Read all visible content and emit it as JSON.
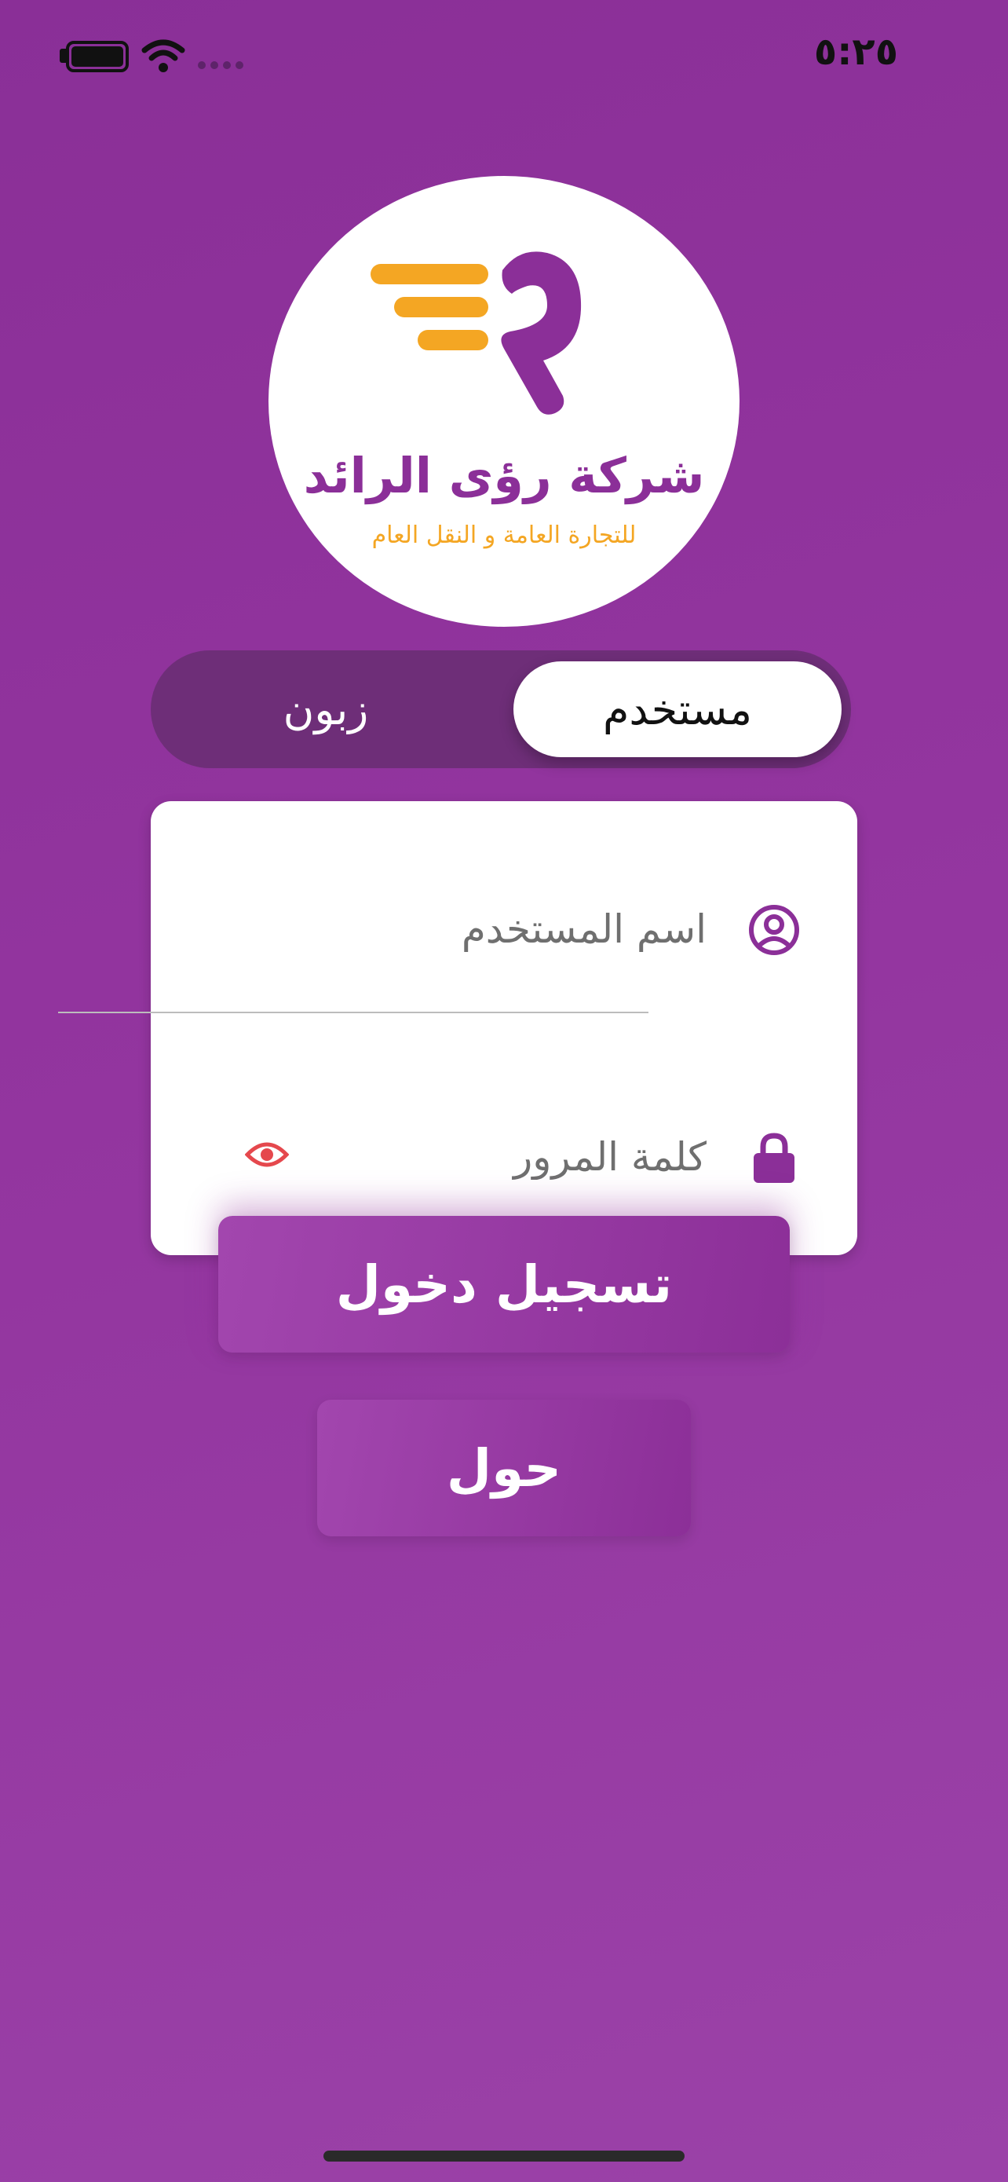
{
  "status_bar": {
    "time": "٥:٢٥"
  },
  "logo": {
    "title": "شركة رؤى الرائد",
    "subtitle": "للتجارة العامة و النقل العام",
    "colors": {
      "purple": "#8b2f98",
      "orange": "#f4a623"
    }
  },
  "account_type": {
    "options": [
      {
        "label": "مستخدم",
        "selected": true
      },
      {
        "label": "زبون",
        "selected": false
      }
    ]
  },
  "form": {
    "username": {
      "placeholder": "اسم المستخدم",
      "value": "",
      "icon": "user-circle-icon"
    },
    "password": {
      "placeholder": "كلمة المرور",
      "value": "",
      "icon": "lock-icon",
      "toggle_icon": "eye-icon"
    }
  },
  "buttons": {
    "login_label": "تسجيل دخول",
    "about_label": "حول"
  },
  "theme": {
    "background": "#93359f",
    "accent_red": "#e5484d"
  }
}
